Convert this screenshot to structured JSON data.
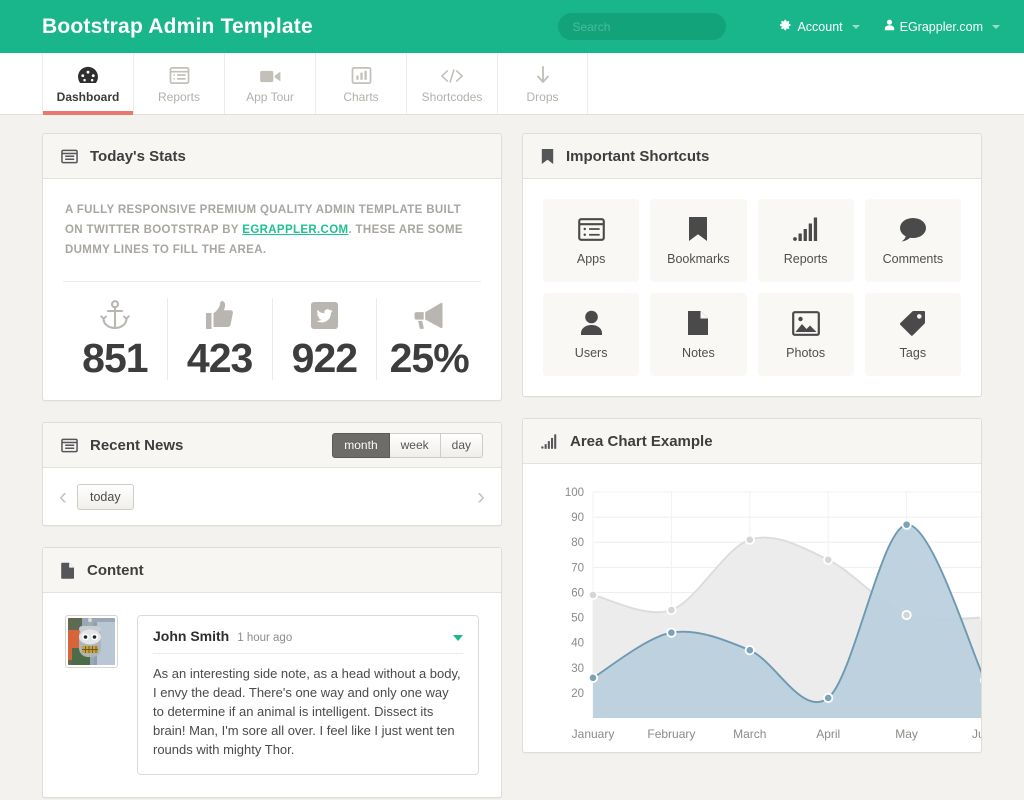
{
  "header": {
    "brand": "Bootstrap Admin Template",
    "search_placeholder": "Search",
    "account_label": "Account",
    "user_label": "EGrappler.com",
    "brand_color": "#18b68a",
    "search_bg": "#13a37b"
  },
  "tabs": [
    {
      "label": "Dashboard",
      "icon": "dashboard-gauge-icon",
      "active": true
    },
    {
      "label": "Reports",
      "icon": "list-report-icon",
      "active": false
    },
    {
      "label": "App Tour",
      "icon": "video-camera-icon",
      "active": false
    },
    {
      "label": "Charts",
      "icon": "bar-chart-icon",
      "active": false
    },
    {
      "label": "Shortcodes",
      "icon": "code-brackets-icon",
      "active": false
    },
    {
      "label": "Drops",
      "icon": "down-arrow-icon",
      "active": false
    }
  ],
  "active_tab_underline_color": "#e8776e",
  "todays_stats": {
    "title": "Today's Stats",
    "icon": "list-panel-icon",
    "description_parts": {
      "before": "A FULLY RESPONSIVE PREMIUM QUALITY ADMIN TEMPLATE BUILT ON TWITTER BOOTSTRAP BY ",
      "link": "EGRAPPLER.COM",
      "after": ". THESE ARE SOME DUMMY LINES TO FILL THE AREA."
    },
    "link_color": "#1ec191",
    "stats": [
      {
        "icon": "anchor-icon",
        "value": "851"
      },
      {
        "icon": "thumbs-up-icon",
        "value": "423"
      },
      {
        "icon": "twitter-icon",
        "value": "922"
      },
      {
        "icon": "megaphone-icon",
        "value": "25%"
      }
    ]
  },
  "shortcuts": {
    "title": "Important Shortcuts",
    "icon": "bookmark-panel-icon",
    "items": [
      {
        "label": "Apps",
        "icon": "apps-list-icon"
      },
      {
        "label": "Bookmarks",
        "icon": "bookmark-icon"
      },
      {
        "label": "Reports",
        "icon": "signal-bars-icon"
      },
      {
        "label": "Comments",
        "icon": "comment-bubble-icon"
      },
      {
        "label": "Users",
        "icon": "user-icon"
      },
      {
        "label": "Notes",
        "icon": "document-icon"
      },
      {
        "label": "Photos",
        "icon": "photo-icon"
      },
      {
        "label": "Tags",
        "icon": "tag-icon"
      }
    ]
  },
  "recent_news": {
    "title": "Recent News",
    "icon": "list-panel-icon",
    "view_buttons": [
      {
        "label": "month",
        "active": true
      },
      {
        "label": "week",
        "active": false
      },
      {
        "label": "day",
        "active": false
      }
    ],
    "prev_label": "‹",
    "next_label": "›",
    "today_label": "today"
  },
  "content_panel": {
    "title": "Content",
    "icon": "document-panel-icon",
    "comment": {
      "avatar": "bender-avatar",
      "author": "John Smith",
      "time": "1 hour ago",
      "text": "As an interesting side note, as a head without a body, I envy the dead. There's one way and only one way to determine if an animal is intelligent. Dissect its brain! Man, I'm sore all over. I feel like I just went ten rounds with mighty Thor."
    }
  },
  "chart_panel": {
    "title": "Area Chart Example",
    "icon": "signal-bars-icon"
  },
  "chart_data": {
    "type": "area",
    "title": "Area Chart Example",
    "categories": [
      "January",
      "February",
      "March",
      "April",
      "May",
      "June"
    ],
    "series": [
      {
        "name": "series-gray",
        "values": [
          59,
          53,
          81,
          73,
          51,
          50
        ],
        "fill": "#ebeaea",
        "stroke": "#dddcdc",
        "point_fill": "#d6d5d5"
      },
      {
        "name": "series-blue",
        "values": [
          26,
          44,
          37,
          18,
          87,
          25
        ],
        "fill": "#b9cfdc",
        "stroke": "#6e99b0",
        "point_fill": "#7ba3b8"
      }
    ],
    "ylim": [
      10,
      100
    ],
    "yticks": [
      20,
      30,
      40,
      50,
      60,
      70,
      80,
      90,
      100
    ],
    "xlabel": "",
    "ylabel": "",
    "grid": true,
    "legend": "none"
  }
}
